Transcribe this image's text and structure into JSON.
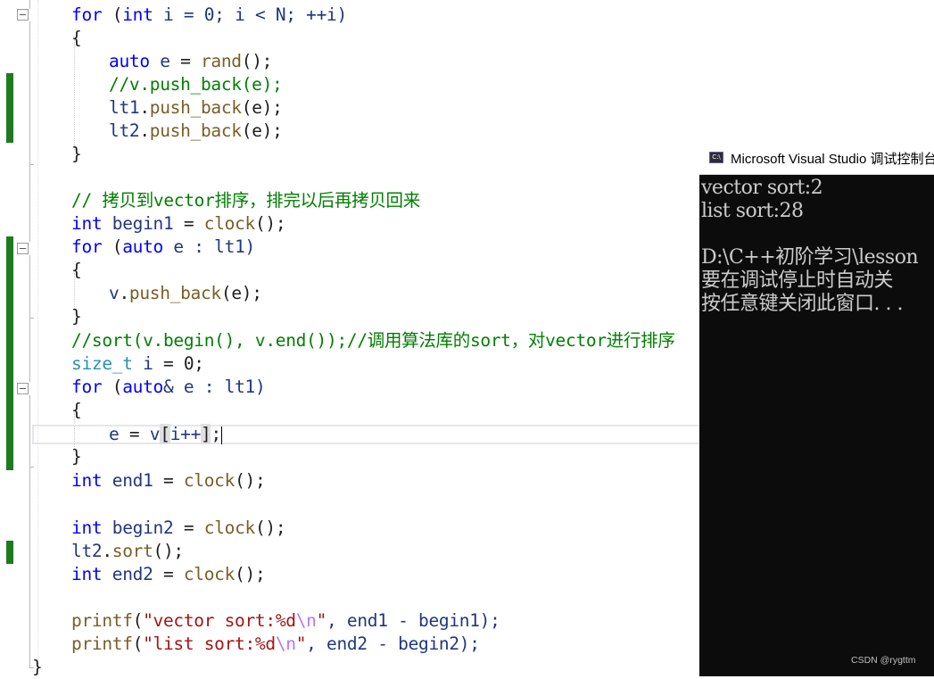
{
  "editor": {
    "lines": {
      "l1": {
        "kw_for": "for",
        "p1": " (",
        "kw_int": "int",
        "rest": " i = 0; i < N; ++i)"
      },
      "l2": {
        "t": "{"
      },
      "l3": {
        "kw": "auto",
        "v": " e",
        "p": " = ",
        "fn": "rand",
        "end": "();"
      },
      "l4": {
        "cm": "//v.push_back(e);"
      },
      "l5": {
        "v": "lt1",
        "p": ".",
        "fn": "push_back",
        "end": "(e);"
      },
      "l6": {
        "v": "lt2",
        "p": ".",
        "fn": "push_back",
        "end": "(e);"
      },
      "l7": {
        "t": "}"
      },
      "l8": {
        "cm": "// 拷贝到vector排序，排完以后再拷贝回来"
      },
      "l9": {
        "kw": "int",
        "v": " begin1",
        "p": " = ",
        "fn": "clock",
        "end": "();"
      },
      "l10": {
        "kw_for": "for",
        "p1": " (",
        "kw_auto": "auto",
        "rest": " e : lt1)"
      },
      "l11": {
        "t": "{"
      },
      "l12": {
        "v": "v",
        "p": ".",
        "fn": "push_back",
        "end": "(e);"
      },
      "l13": {
        "t": "}"
      },
      "l14": {
        "cm": "//sort(v.begin(), v.end());//调用算法库的sort，对vector进行排序"
      },
      "l15": {
        "ty": "size_t",
        "v": " i",
        "end": " = 0;"
      },
      "l16": {
        "kw_for": "for",
        "p1": " (",
        "kw_auto": "auto",
        "rest": "& e : lt1)"
      },
      "l17": {
        "t": "{"
      },
      "l18": {
        "v": "e",
        "p": " = ",
        "v2": "v",
        "br1": "[",
        "v3": "i++",
        "br2": "]",
        "end": ";"
      },
      "l19": {
        "t": "}"
      },
      "l20": {
        "kw": "int",
        "v": " end1",
        "p": " = ",
        "fn": "clock",
        "end": "();"
      },
      "l21": {
        "kw": "int",
        "v": " begin2",
        "p": " = ",
        "fn": "clock",
        "end": "();"
      },
      "l22": {
        "v": "lt2",
        "p": ".",
        "fn": "sort",
        "end": "();"
      },
      "l23": {
        "kw": "int",
        "v": " end2",
        "p": " = ",
        "fn": "clock",
        "end": "();"
      },
      "l24": {
        "fn": "printf",
        "p": "(",
        "st1": "\"vector sort:%d",
        "es": "\\n",
        "st2": "\"",
        "rest": ", end1 - begin1);"
      },
      "l25": {
        "fn": "printf",
        "p": "(",
        "st1": "\"list sort:%d",
        "es": "\\n",
        "st2": "\"",
        "rest": ", end2 - begin2);"
      },
      "l26": {
        "t": "}"
      }
    }
  },
  "console": {
    "title": "Microsoft Visual Studio 调试控制台",
    "icon_label": "C:\\",
    "lines": [
      "vector sort:2",
      "list sort:28",
      "",
      "D:\\C++初阶学习\\lesson",
      "要在调试停止时自动关",
      "按任意键关闭此窗口. . ."
    ],
    "background": "#0c0c0c",
    "text_color": "#cccccc"
  },
  "watermark": "CSDN @rygttm",
  "colors": {
    "keyword": "#0000ff",
    "type": "#2b91af",
    "function": "#795e26",
    "variable": "#1f377f",
    "comment": "#008000",
    "string": "#a31515",
    "change_bar": "#1f7a1f"
  }
}
